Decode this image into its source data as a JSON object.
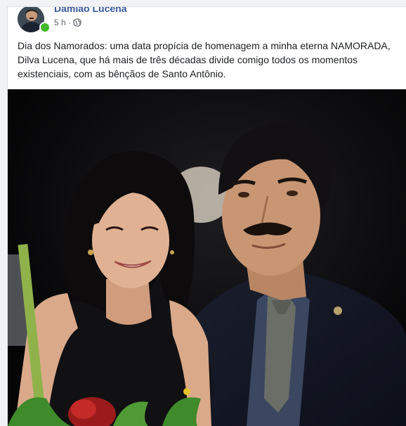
{
  "post": {
    "author": "Damião Lucena",
    "time": "5 h",
    "separator": "·",
    "privacy_icon": "globe-icon",
    "text": "Dia dos Namorados: uma data propícia de homenagem a minha eterna NAMORADA, Dilva Lucena, que há mais de três décadas divide comigo todos os momentos existenciais, com as bênçãos de Santo Antônio."
  },
  "colors": {
    "author_link": "#385898",
    "online": "#42b72a",
    "background": "#f0f2f5"
  }
}
